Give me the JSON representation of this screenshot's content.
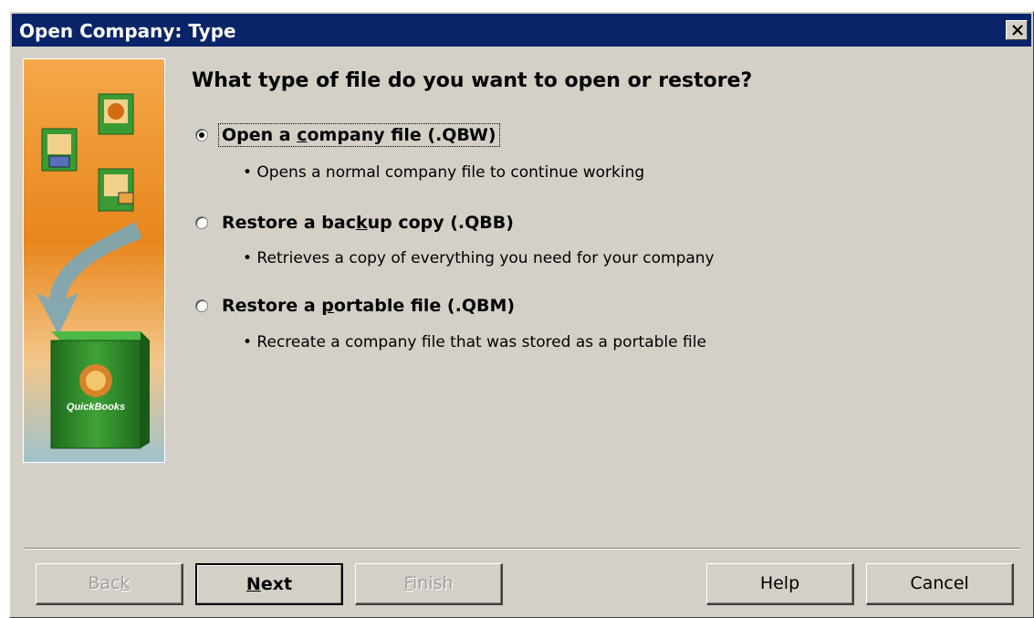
{
  "window": {
    "title": "Open Company: Type",
    "close_glyph": "✕"
  },
  "side_image": {
    "box_label": "QuickBooks",
    "colors": {
      "orange": "#e8861c",
      "green": "#2f8a2a",
      "arrow": "#7aa7b8",
      "bottom": "#9fc2cc"
    }
  },
  "question": "What type of file do you want to open or restore?",
  "options": [
    {
      "label_pre": "Open a ",
      "label_mnemonic": "c",
      "label_post": "ompany file (.QBW)",
      "description": "• Opens a normal company file to continue working",
      "selected": true
    },
    {
      "label_pre": "Restore a bac",
      "label_mnemonic": "k",
      "label_post": "up copy (.QBB)",
      "description": "• Retrieves a copy of everything you need for your company",
      "selected": false
    },
    {
      "label_pre": "Restore a ",
      "label_mnemonic": "p",
      "label_post": "ortable file (.QBM)",
      "description": "• Recreate a company file that was stored as a portable file",
      "selected": false
    }
  ],
  "buttons": {
    "back": {
      "pre": "Bac",
      "mn": "k",
      "post": "",
      "enabled": false
    },
    "next": {
      "pre": "",
      "mn": "N",
      "post": "ext",
      "enabled": true
    },
    "finish": {
      "pre": "",
      "mn": "F",
      "post": "inish",
      "enabled": false
    },
    "help": {
      "label": "Help",
      "enabled": true
    },
    "cancel": {
      "label": "Cancel",
      "enabled": true
    }
  }
}
